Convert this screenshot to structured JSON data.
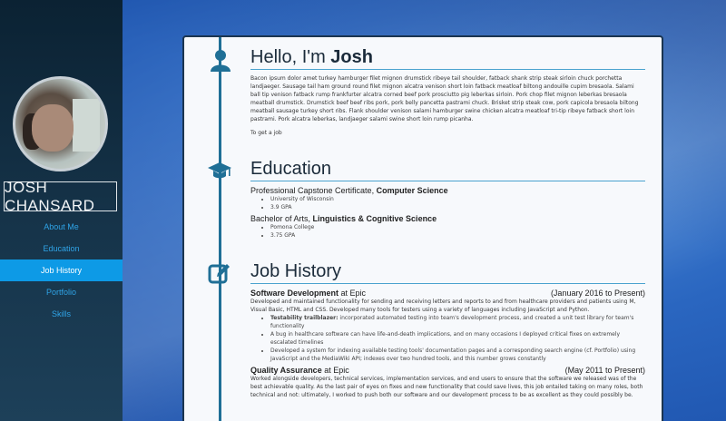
{
  "sidebar": {
    "name": "JOSH CHANSARD",
    "nav": [
      "About Me",
      "Education",
      "Job History",
      "Portfolio",
      "Skills"
    ],
    "active_index": 2
  },
  "about": {
    "title_prefix": "Hello, I'm ",
    "title_name": "Josh",
    "body": "Bacon ipsum dolor amet turkey hamburger filet mignon drumstick ribeye tail shoulder, fatback shank strip steak sirloin chuck porchetta landjaeger. Sausage tail ham ground round filet mignon alcatra venison short loin fatback meatloaf biltong andouille cupim bresaola. Salami ball tip venison fatback rump frankfurter alcatra corned beef pork prosciutto pig leberkas sirloin. Pork chop filet mignon leberkas bresaola meatball drumstick. Drumstick beef beef ribs pork, pork belly pancetta pastrami chuck. Brisket strip steak cow, pork capicola bresaola biltong meatball sausage turkey short ribs. Flank shoulder venison salami hamburger swine chicken alcatra meatloaf tri-tip ribeye fatback short loin pastrami. Pork alcatra leberkas, landjaeger salami swine short loin rump picanha.",
    "link": "To get a job"
  },
  "education": {
    "title": "Education",
    "degrees": [
      {
        "prefix": "Professional Capstone Certificate, ",
        "field": "Computer Science",
        "details": [
          "University of Wisconsin",
          "3.9 GPA"
        ]
      },
      {
        "prefix": "Bachelor of Arts, ",
        "field": "Linguistics & Cognitive Science",
        "details": [
          "Pomona College",
          "3.75 GPA"
        ]
      }
    ]
  },
  "jobs": {
    "title": "Job History",
    "items": [
      {
        "role": "Software Development",
        "company": " at Epic",
        "dates": "(January 2016 to Present)",
        "summary": "Developed and maintained functionality for sending and receiving letters and reports to and from healthcare providers and patients using M, Visual Basic, HTML and CSS. Developed many tools for testers using a variety of languages including JavaScript and Python.",
        "bullets": [
          {
            "strong": "Testability trailblazer:",
            "text": " incorporated automated testing into team's development process, and created a unit test library for team's functionality"
          },
          {
            "strong": "",
            "text": "A bug in healthcare software can have life-and-death implications, and on many occasions I deployed critical fixes on extremely escalated timelines"
          },
          {
            "strong": "",
            "text": "Developed a system for indexing available testing tools' documentation pages and a corresponding search engine (cf. Portfolio) using JavaScript and the MediaWiki API; indexes over two hundred tools, and this number grows constantly"
          }
        ]
      },
      {
        "role": "Quality Assurance",
        "company": " at Epic",
        "dates": "(May 2011 to Present)",
        "summary": "Worked alongside developers, technical services, implementation services, and end users to ensure that the software we released was of the best achievable quality. As the last pair of eyes on fixes and new functionality that could save lives, this job entailed taking on many roles, both technical and not: ultimately, I worked to push both our software and our development process to be as excellent as they could possibly be."
      }
    ]
  },
  "colors": {
    "accent": "#1f6f96",
    "nav_active": "#0d9ae6",
    "nav_text": "#2fa4e7"
  },
  "icons": [
    "user-icon",
    "graduation-cap-icon",
    "edit-icon"
  ]
}
